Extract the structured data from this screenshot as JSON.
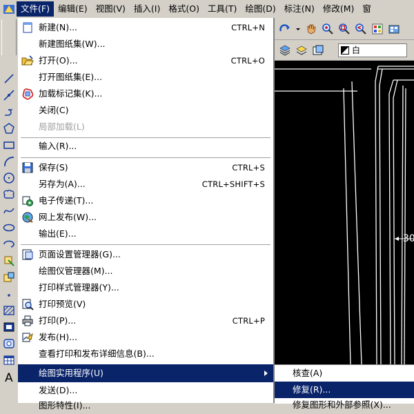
{
  "menubar": {
    "items": [
      "文件(F)",
      "编辑(E)",
      "视图(V)",
      "插入(I)",
      "格式(O)",
      "工具(T)",
      "绘图(D)",
      "标注(N)",
      "修改(M)",
      "窗"
    ]
  },
  "layer": {
    "name": "白"
  },
  "canvas": {
    "dimension_text": "30"
  },
  "file_menu": {
    "new": {
      "label": "新建(N)...",
      "shortcut": "CTRL+N"
    },
    "new_sheet_set": {
      "label": "新建图纸集(W)..."
    },
    "open": {
      "label": "打开(O)...",
      "shortcut": "CTRL+O"
    },
    "open_sheet_set": {
      "label": "打开图纸集(E)..."
    },
    "load_markup": {
      "label": "加载标记集(K)..."
    },
    "close": {
      "label": "关闭(C)"
    },
    "partial_load": {
      "label": "局部加载(L)"
    },
    "import": {
      "label": "输入(R)..."
    },
    "save": {
      "label": "保存(S)",
      "shortcut": "CTRL+S"
    },
    "save_as": {
      "label": "另存为(A)...",
      "shortcut": "CTRL+SHIFT+S"
    },
    "etransmit": {
      "label": "电子传递(T)..."
    },
    "publish_web": {
      "label": "网上发布(W)..."
    },
    "export": {
      "label": "输出(E)..."
    },
    "page_setup": {
      "label": "页面设置管理器(G)..."
    },
    "plotter_manager": {
      "label": "绘图仪管理器(M)..."
    },
    "plot_style_manager": {
      "label": "打印样式管理器(Y)..."
    },
    "plot_preview": {
      "label": "打印预览(V)"
    },
    "plot": {
      "label": "打印(P)...",
      "shortcut": "CTRL+P"
    },
    "publish": {
      "label": "发布(H)..."
    },
    "plot_details": {
      "label": "查看打印和发布详细信息(B)..."
    },
    "drawing_utilities": {
      "label": "绘图实用程序(U)"
    },
    "send": {
      "label": "发送(D)..."
    },
    "drawing_properties": {
      "label": "图形特性(I)..."
    }
  },
  "submenu": {
    "audit": {
      "label": "核查(A)"
    },
    "recover": {
      "label": "修复(R)..."
    },
    "recover_xref": {
      "label": "修复图形和外部参照(X)..."
    }
  },
  "colors": {
    "selection": "#0a246a",
    "chrome": "#d4d0c8",
    "canvas": "#000000"
  }
}
